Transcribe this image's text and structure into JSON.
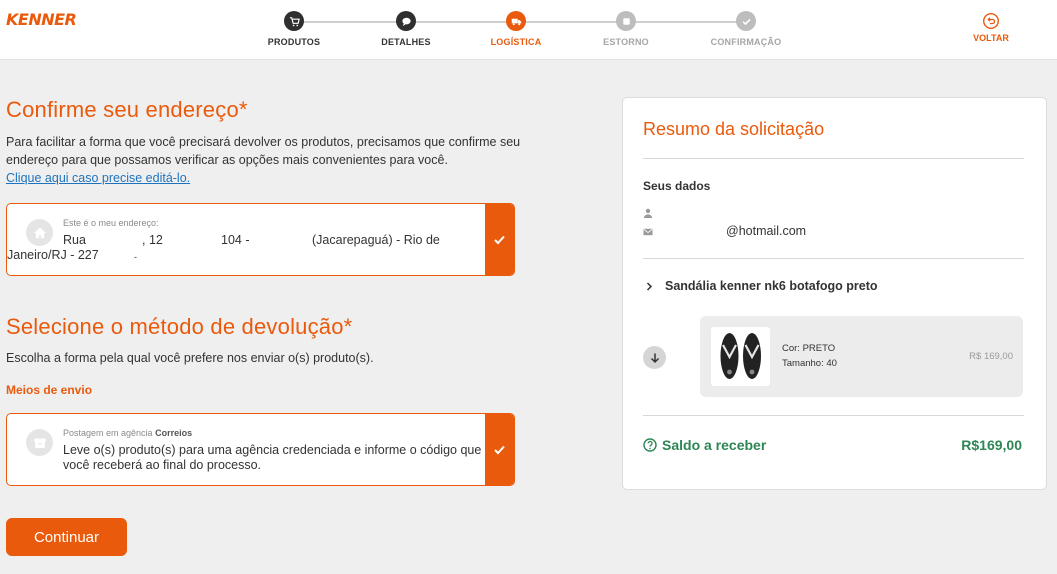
{
  "brand": {
    "logo": "KENNER",
    "accent": "#ea5a0c",
    "success": "#2d8654"
  },
  "stepper": {
    "steps": [
      {
        "label": "PRODUTOS",
        "state": "done",
        "icon": "cart-icon"
      },
      {
        "label": "DETALHES",
        "state": "done",
        "icon": "chat-icon"
      },
      {
        "label": "LOGÍSTICA",
        "state": "active",
        "icon": "truck-icon"
      },
      {
        "label": "ESTORNO",
        "state": "pending",
        "icon": "square-icon"
      },
      {
        "label": "CONFIRMAÇÃO",
        "state": "pending",
        "icon": "check-icon"
      }
    ],
    "back_label": "VOLTAR"
  },
  "address": {
    "title": "Confirme seu endereço*",
    "description": "Para facilitar a forma que você precisará devolver os produtos, precisamos que confirme seu endereço para que possamos verificar as opções mais convenientes para você.",
    "edit_link": "Clique aqui caso precise editá-lo.",
    "card_caption": "Este é o meu endereço:",
    "street": "Rua",
    "number": ", 12",
    "complement": "104 -",
    "district": "(Jacarepaguá) - Rio de",
    "city_line": "Janeiro/RJ - 227",
    "city_extra": "-"
  },
  "return_method": {
    "title": "Selecione o método de devolução*",
    "description": "Escolha a forma pela qual você prefere nos enviar o(s) produto(s).",
    "shipping_label": "Meios de envio",
    "option_caption": "Postagem em agência",
    "option_carrier": "Correios",
    "option_text": "Leve o(s) produto(s) para uma agência credenciada e informe o código que você receberá ao final do processo."
  },
  "continue_label": "Continuar",
  "summary": {
    "title": "Resumo da solicitação",
    "your_data_label": "Seus dados",
    "email": "@hotmail.com",
    "product_name": "Sandália kenner nk6 botafogo preto",
    "item": {
      "color": "Cor: PRETO",
      "size": "Tamanho: 40",
      "price": "R$ 169,00"
    },
    "balance_label": "Saldo a receber",
    "balance_value": "R$169,00"
  }
}
